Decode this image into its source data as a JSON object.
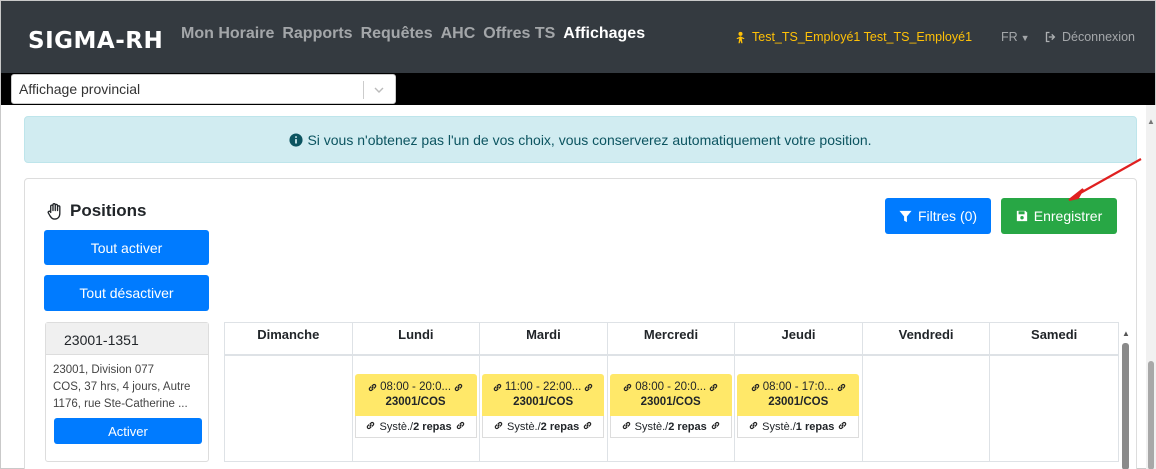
{
  "navbar": {
    "brand": "SIGMA-RH",
    "links": [
      {
        "label": "Mon Horaire",
        "active": false
      },
      {
        "label": "Rapports",
        "active": false
      },
      {
        "label": "Requêtes",
        "active": false
      },
      {
        "label": "AHC",
        "active": false
      },
      {
        "label": "Offres TS",
        "active": false
      },
      {
        "label": "Affichages",
        "active": true
      }
    ],
    "user_icon": "user-icon",
    "user_name": "Test_TS_Employé1 Test_TS_Employé1",
    "language": "FR",
    "logout_icon": "sign-out-icon",
    "logout_label": "Déconnexion"
  },
  "select": {
    "value": "Affichage provincial",
    "chevron_icon": "chevron-down-icon"
  },
  "alert": {
    "icon": "info-circle-icon",
    "text": "Si vous n'obtenez pas l'un de vos choix, vous conserverez automatiquement votre position."
  },
  "positions": {
    "title": "Positions",
    "title_icon": "hand-pointer-icon",
    "activate_all": "Tout activer",
    "deactivate_all": "Tout désactiver",
    "filters_label": "Filtres (0)",
    "filters_icon": "filter-icon",
    "save_label": "Enregistrer",
    "save_icon": "save-icon",
    "arrow_color": "#e02020"
  },
  "position_card": {
    "header": "23001-1351",
    "lines": [
      "23001, Division 077",
      "COS, 37 hrs, 4 jours, Autre",
      "1176, rue Ste-Catherine ..."
    ],
    "activate_label": "Activer"
  },
  "calendar": {
    "days": [
      "Dimanche",
      "Lundi",
      "Mardi",
      "Mercredi",
      "Jeudi",
      "Vendredi",
      "Samedi"
    ],
    "shifts": [
      {
        "day": "Lundi",
        "time": "08:00 - 20:0...",
        "code": "23001/COS",
        "system": "Systè./",
        "meals": "2 repas"
      },
      {
        "day": "Mardi",
        "time": "11:00 - 22:00...",
        "code": "23001/COS",
        "system": "Systè./",
        "meals": "2 repas"
      },
      {
        "day": "Mercredi",
        "time": "08:00 - 20:0...",
        "code": "23001/COS",
        "system": "Systè./",
        "meals": "2 repas"
      },
      {
        "day": "Jeudi",
        "time": "08:00 - 17:0...",
        "code": "23001/COS",
        "system": "Systè./",
        "meals": "1 repas"
      }
    ],
    "link_icon": "link-icon"
  },
  "colors": {
    "navbar": "#343a40",
    "primary": "#007bff",
    "success": "#28a745",
    "shift": "#ffe869",
    "alert_bg": "#d1ecf1",
    "user": "#ffc107"
  }
}
